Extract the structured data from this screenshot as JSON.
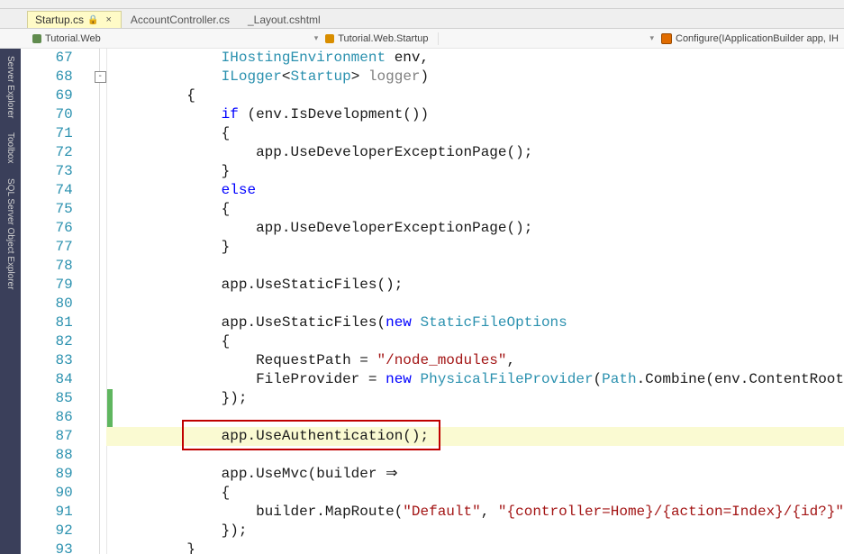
{
  "tabs": [
    {
      "label": "Startup.cs",
      "active": true,
      "locked": true
    },
    {
      "label": "AccountController.cs",
      "active": false,
      "locked": false
    },
    {
      "label": "_Layout.cshtml",
      "active": false,
      "locked": false
    }
  ],
  "breadcrumb": {
    "project": "Tutorial.Web",
    "namespace": "Tutorial.Web.Startup",
    "method": "Configure(IApplicationBuilder app, IH"
  },
  "side_tabs": [
    "Server Explorer",
    "Toolbox",
    "SQL Server Object Explorer"
  ],
  "editor": {
    "first_line_number": 67,
    "highlighted_line": 87,
    "red_box_line": 87,
    "fold_minus_at": 68,
    "green_mod_bars": [
      {
        "from": 85,
        "to": 87
      }
    ],
    "lines": [
      {
        "n": 67,
        "indent": "            ",
        "tokens": [
          {
            "t": "IHostingEnvironment",
            "c": "tk-type"
          },
          {
            "t": " env,"
          }
        ]
      },
      {
        "n": 68,
        "indent": "            ",
        "tokens": [
          {
            "t": "ILogger",
            "c": "tk-type"
          },
          {
            "t": "<"
          },
          {
            "t": "Startup",
            "c": "tk-type"
          },
          {
            "t": "> "
          },
          {
            "t": "logger",
            "c": "tk-faded"
          },
          {
            "t": ")"
          }
        ]
      },
      {
        "n": 69,
        "indent": "        ",
        "tokens": [
          {
            "t": "{"
          }
        ]
      },
      {
        "n": 70,
        "indent": "            ",
        "tokens": [
          {
            "t": "if",
            "c": "tk-kw"
          },
          {
            "t": " (env.IsDevelopment())"
          }
        ]
      },
      {
        "n": 71,
        "indent": "            ",
        "tokens": [
          {
            "t": "{"
          }
        ]
      },
      {
        "n": 72,
        "indent": "                ",
        "tokens": [
          {
            "t": "app.UseDeveloperExceptionPage();"
          }
        ]
      },
      {
        "n": 73,
        "indent": "            ",
        "tokens": [
          {
            "t": "}"
          }
        ]
      },
      {
        "n": 74,
        "indent": "            ",
        "tokens": [
          {
            "t": "else",
            "c": "tk-kw"
          }
        ]
      },
      {
        "n": 75,
        "indent": "            ",
        "tokens": [
          {
            "t": "{"
          }
        ]
      },
      {
        "n": 76,
        "indent": "                ",
        "tokens": [
          {
            "t": "app.UseDeveloperExceptionPage();"
          }
        ]
      },
      {
        "n": 77,
        "indent": "            ",
        "tokens": [
          {
            "t": "}"
          }
        ]
      },
      {
        "n": 78,
        "indent": "",
        "tokens": []
      },
      {
        "n": 79,
        "indent": "            ",
        "tokens": [
          {
            "t": "app.UseStaticFiles();"
          }
        ]
      },
      {
        "n": 80,
        "indent": "",
        "tokens": []
      },
      {
        "n": 81,
        "indent": "            ",
        "tokens": [
          {
            "t": "app.UseStaticFiles("
          },
          {
            "t": "new",
            "c": "tk-kw"
          },
          {
            "t": " "
          },
          {
            "t": "StaticFileOptions",
            "c": "tk-type"
          }
        ]
      },
      {
        "n": 82,
        "indent": "            ",
        "tokens": [
          {
            "t": "{"
          }
        ]
      },
      {
        "n": 83,
        "indent": "                ",
        "tokens": [
          {
            "t": "RequestPath = "
          },
          {
            "t": "\"/node_modules\"",
            "c": "tk-str"
          },
          {
            "t": ","
          }
        ]
      },
      {
        "n": 84,
        "indent": "                ",
        "tokens": [
          {
            "t": "FileProvider = "
          },
          {
            "t": "new",
            "c": "tk-kw"
          },
          {
            "t": " "
          },
          {
            "t": "PhysicalFileProvider",
            "c": "tk-type"
          },
          {
            "t": "("
          },
          {
            "t": "Path",
            "c": "tk-type"
          },
          {
            "t": ".Combine(env.ContentRoot"
          }
        ]
      },
      {
        "n": 85,
        "indent": "            ",
        "tokens": [
          {
            "t": "});"
          }
        ]
      },
      {
        "n": 86,
        "indent": "",
        "tokens": []
      },
      {
        "n": 87,
        "indent": "            ",
        "tokens": [
          {
            "t": "app.UseAuthentication();"
          }
        ]
      },
      {
        "n": 88,
        "indent": "",
        "tokens": []
      },
      {
        "n": 89,
        "indent": "            ",
        "tokens": [
          {
            "t": "app.UseMvc(builder "
          },
          {
            "t": "⇒"
          }
        ]
      },
      {
        "n": 90,
        "indent": "            ",
        "tokens": [
          {
            "t": "{"
          }
        ]
      },
      {
        "n": 91,
        "indent": "                ",
        "tokens": [
          {
            "t": "builder.MapRoute("
          },
          {
            "t": "\"Default\"",
            "c": "tk-str"
          },
          {
            "t": ", "
          },
          {
            "t": "\"{controller=Home}/{action=Index}/{id?}\"",
            "c": "tk-str"
          }
        ]
      },
      {
        "n": 92,
        "indent": "            ",
        "tokens": [
          {
            "t": "});"
          }
        ]
      },
      {
        "n": 93,
        "indent": "        ",
        "tokens": [
          {
            "t": "}"
          }
        ]
      }
    ]
  }
}
